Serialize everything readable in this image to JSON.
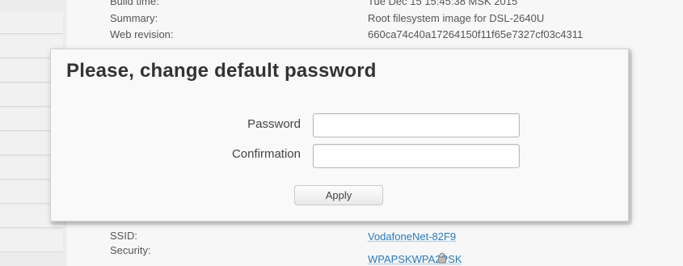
{
  "info": {
    "build_time_label": "Build time:",
    "build_time_value": "Tue Dec 15 15:45:38 MSK 2015",
    "summary_label": "Summary:",
    "summary_value": "Root filesystem image for DSL-2640U",
    "web_revision_label": "Web revision:",
    "web_revision_value": "660ca74c40a17264150f11f65e7327cf03c4311"
  },
  "dialog": {
    "title": "Please, change default password",
    "password_label": "Password",
    "password_value": "",
    "confirmation_label": "Confirmation",
    "confirmation_value": "",
    "apply_label": "Apply"
  },
  "wifi": {
    "ssid_label": "SSID:",
    "ssid_value": "VodafoneNet-82F9",
    "security_label": "Security:",
    "security_value": "WPAPSKWPA2PSK",
    "security_icon": "lock-icon"
  }
}
